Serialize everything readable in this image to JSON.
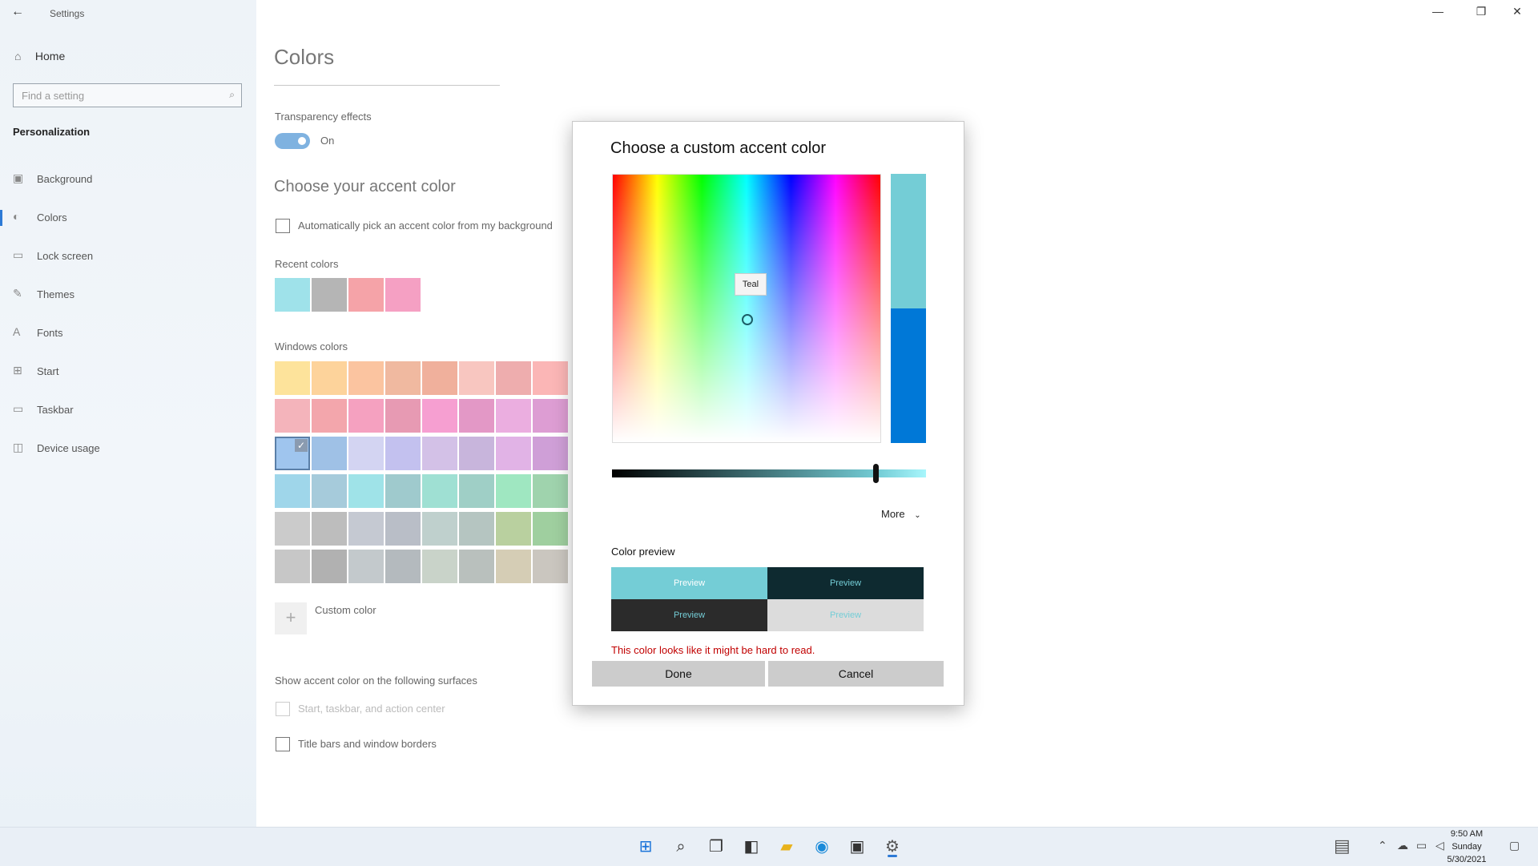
{
  "window": {
    "title": "Settings",
    "back_glyph": "←",
    "min_glyph": "—",
    "max_glyph": "❐",
    "close_glyph": "✕"
  },
  "sidebar": {
    "home_label": "Home",
    "search_placeholder": "Find a setting",
    "section": "Personalization",
    "items": [
      {
        "label": "Background",
        "icon": "image-icon",
        "glyph": "▣"
      },
      {
        "label": "Colors",
        "icon": "palette-icon",
        "glyph": "◐"
      },
      {
        "label": "Lock screen",
        "icon": "monitor-icon",
        "glyph": "▭"
      },
      {
        "label": "Themes",
        "icon": "brush-icon",
        "glyph": "✎"
      },
      {
        "label": "Fonts",
        "icon": "font-icon",
        "glyph": "A"
      },
      {
        "label": "Start",
        "icon": "grid-icon",
        "glyph": "⊞"
      },
      {
        "label": "Taskbar",
        "icon": "taskbar-icon",
        "glyph": "▭"
      },
      {
        "label": "Device usage",
        "icon": "device-icon",
        "glyph": "◫"
      }
    ],
    "active_index": 1
  },
  "main": {
    "title": "Colors",
    "transparency_label": "Transparency effects",
    "transparency_state": "On",
    "accent_heading": "Choose your accent color",
    "auto_pick_label": "Automatically pick an accent color from my background",
    "recent_label": "Recent colors",
    "recent_colors": [
      "#9fe2ea",
      "#b5b5b5",
      "#f5a3a8",
      "#f5a0c3"
    ],
    "windows_label": "Windows colors",
    "windows_colors": [
      [
        "#fde39b",
        "#fdd39b",
        "#fbc4a0",
        "#f0b9a0",
        "#f0b09c",
        "#f8c6c0",
        "#eeadae",
        "#fbb6b6"
      ],
      [
        "#f4b4bb",
        "#f3a6ac",
        "#f5a1c0",
        "#e79ab3",
        "#f69fd1",
        "#e398c6",
        "#ebaee0",
        "#dd9dd3"
      ],
      [
        "#9fc5ee",
        "#9fc1e6",
        "#d3d4f2",
        "#c3c1ef",
        "#d3c1e7",
        "#c8b5dc",
        "#e1b3e6",
        "#cf9fd7"
      ],
      [
        "#9fd6ea",
        "#a6cbdb",
        "#9fe3e8",
        "#9fcacd",
        "#9fe0d3",
        "#9fcfc6",
        "#9fe7c1",
        "#9fd3ad"
      ],
      [
        "#cbcbcb",
        "#bdbdbd",
        "#c5c9d2",
        "#b9bec7",
        "#bfd0cd",
        "#b5c5c1",
        "#b9d09f",
        "#9fcf9f"
      ],
      [
        "#c7c7c7",
        "#b1b1b1",
        "#c3c9cc",
        "#b4babe",
        "#c9d3c9",
        "#b9c0bd",
        "#d5cdb5",
        "#cac6bf"
      ]
    ],
    "selected_swatch": {
      "row": 2,
      "col": 0
    },
    "custom_color_label": "Custom color",
    "surfaces_heading": "Show accent color on the following surfaces",
    "surface_1": "Start, taskbar, and action center",
    "surface_2": "Title bars and window borders"
  },
  "dialog": {
    "title": "Choose a custom accent color",
    "tooltip": "Teal",
    "new_color": "#74cdd6",
    "old_color": "#0078d7",
    "brightness_fraction": 0.84,
    "more_label": "More",
    "color_preview_label": "Color preview",
    "preview_text": "Preview",
    "preview_tiles": [
      {
        "bg": "#74cdd6",
        "fg": "#ffffff"
      },
      {
        "bg": "#0e2a30",
        "fg": "#74cdd6"
      },
      {
        "bg": "#2b2b2b",
        "fg": "#74cdd6"
      },
      {
        "bg": "#dcdcdc",
        "fg": "#74cdd6"
      }
    ],
    "warning": "This color looks like it might be hard to read.",
    "done_label": "Done",
    "cancel_label": "Cancel"
  },
  "taskbar": {
    "icons": [
      "windows-start-icon",
      "search-icon",
      "task-view-icon",
      "widgets-icon",
      "file-explorer-icon",
      "edge-icon",
      "store-icon",
      "settings-icon"
    ],
    "time": "9:50 AM",
    "day": "Sunday",
    "date": "5/30/2021"
  }
}
